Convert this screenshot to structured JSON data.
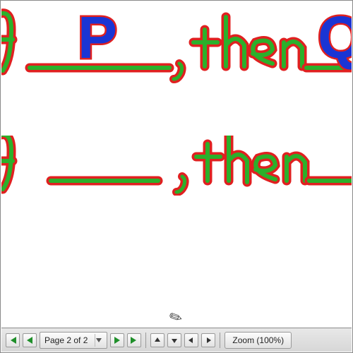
{
  "canvas": {
    "line1_if": "f",
    "line1_then": "then",
    "line1_var_p": "P",
    "line1_var_q": "Q",
    "line2_if": "f",
    "line2_then": "then"
  },
  "toolbar": {
    "page_label": "Page 2 of 2",
    "zoom_label": "Zoom (100%)",
    "icons": {
      "first": "first-page",
      "prev_set": "prev-set",
      "next_set": "next-set",
      "last": "last-page",
      "up": "up",
      "down": "down",
      "left": "left",
      "right": "right"
    }
  },
  "colors": {
    "stroke_outline": "#e02020",
    "stroke_fill": "#2bb02b",
    "var_fill": "#1a35d4",
    "toolbar_arrow": "#1f8f2a"
  }
}
